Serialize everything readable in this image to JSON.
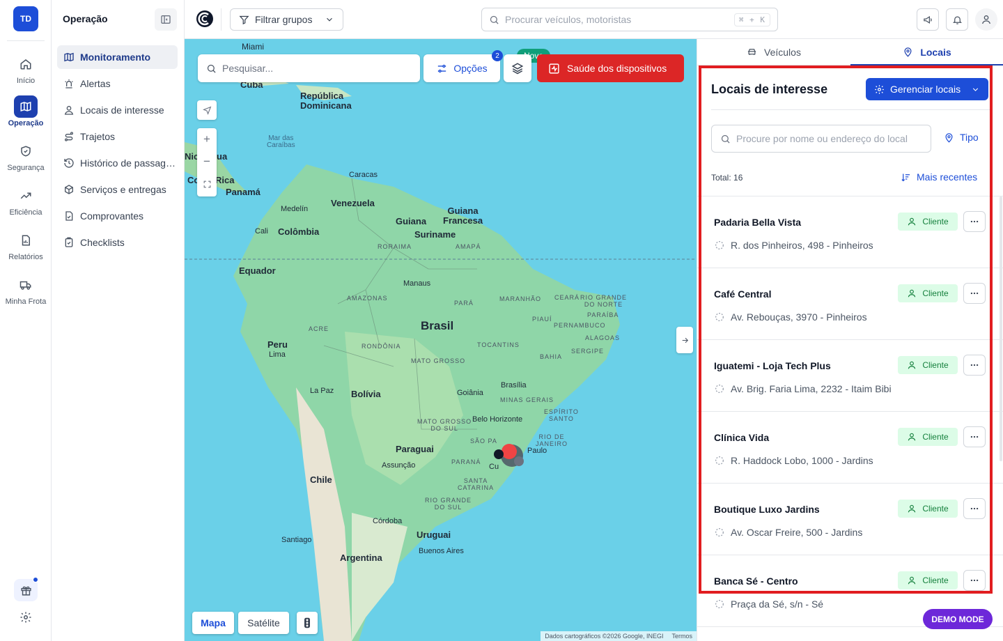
{
  "rail": {
    "avatar": "TD",
    "items": [
      {
        "label": "Início"
      },
      {
        "label": "Operação"
      },
      {
        "label": "Segurança"
      },
      {
        "label": "Eficiência"
      },
      {
        "label": "Relatórios"
      },
      {
        "label": "Minha Frota"
      }
    ]
  },
  "sidebar": {
    "title": "Operação",
    "items": [
      {
        "label": "Monitoramento"
      },
      {
        "label": "Alertas"
      },
      {
        "label": "Locais de interesse"
      },
      {
        "label": "Trajetos"
      },
      {
        "label": "Histórico de passagens"
      },
      {
        "label": "Serviços e entregas"
      },
      {
        "label": "Comprovantes"
      },
      {
        "label": "Checklists"
      }
    ]
  },
  "topbar": {
    "filter_label": "Filtrar grupos",
    "search_placeholder": "Procurar veículos, motoristas",
    "shortcut": "⌘ + K"
  },
  "map": {
    "search_placeholder": "Pesquisar...",
    "options_label": "Opções",
    "options_badge": "2",
    "new_tag": "Novo",
    "health_label": "Saúde dos dispositivos",
    "map_type_map": "Mapa",
    "map_type_satellite": "Satélite",
    "attribution": "Dados cartográficos ©2026 Google, INEGI",
    "terms": "Termos",
    "labels": {
      "miami": "Miami",
      "cuba": "Cuba",
      "dominicana": "República\nDominicana",
      "caribe": "Mar das\nCaraíbas",
      "caracas": "Caracas",
      "nicaragua": "Nic",
      "nicaragua2": "ua",
      "costarica": "Co",
      "costarica2": "Rica",
      "panama": "Panamá",
      "medellin": "Medelín",
      "venezuela": "Venezuela",
      "guiana": "Guiana",
      "guianafr": "Guiana\nFrancesa",
      "suriname": "Suriname",
      "cali": "Cali",
      "colombia": "Colômbia",
      "roraima": "RORAIMA",
      "amapa": "AMAPÁ",
      "equador": "Equador",
      "manaus": "Manaus",
      "amazonas": "AMAZONAS",
      "para": "PARÁ",
      "maranhao": "MARANHÃO",
      "ceara": "CEARÁ",
      "rgnorte": "RIO GRANDE\nDO NORTE",
      "paraiba": "PARAÍBA",
      "piaui": "PIAUÍ",
      "pernambuco": "PERNAMBUCO",
      "alagoas": "ALAGOAS",
      "sergipe": "SERGIPE",
      "acre": "ACRE",
      "brasil": "Brasil",
      "tocantins": "TOCANTINS",
      "bahia": "BAHIA",
      "rondonia": "RONDÔNIA",
      "matogrosso": "MATO GROSSO",
      "peru": "Peru",
      "lima": "Lima",
      "brasilia": "Brasília",
      "lapaz": "La Paz",
      "bolivia": "Bolívia",
      "goiania": "Goiânia",
      "minas": "MINAS GERAIS",
      "espirito": "ESPÍRITO\nSANTO",
      "ms": "MATO GROSSO\nDO SUL",
      "bh": "Belo Horizonte",
      "riojaneiro": "RIO DE\nJANEIRO",
      "saopaulo_st": "SÃO PA",
      "saopaulo": "Paulo",
      "paraguai": "Paraguai",
      "assuncao": "Assunção",
      "parana": "PARANÁ",
      "curitiba": "Cu",
      "chile": "Chile",
      "santacatarina": "SANTA\nCATARINA",
      "rgsul": "RIO GRANDE\nDO SUL",
      "cordoba": "Córdoba",
      "uruguai": "Uruguai",
      "santiago": "Santiago",
      "buenosaires": "Buenos Aires",
      "argentina": "Argentina"
    }
  },
  "panel": {
    "tabs": [
      {
        "label": "Veículos"
      },
      {
        "label": "Locais"
      }
    ],
    "title": "Locais de interesse",
    "manage_label": "Gerenciar locais",
    "search_placeholder": "Procure por nome ou endereço do local",
    "type_label": "Tipo",
    "total_label": "Total: 16",
    "sort_label": "Mais recentes",
    "locations": [
      {
        "name": "Padaria Bella Vista",
        "badge": "Cliente",
        "address": "R. dos Pinheiros, 498 - Pinheiros"
      },
      {
        "name": "Café Central",
        "badge": "Cliente",
        "address": "Av. Rebouças, 3970 - Pinheiros"
      },
      {
        "name": "Iguatemi - Loja Tech Plus",
        "badge": "Cliente",
        "address": "Av. Brig. Faria Lima, 2232 - Itaim Bibi"
      },
      {
        "name": "Clínica Vida",
        "badge": "Cliente",
        "address": "R. Haddock Lobo, 1000 - Jardins"
      },
      {
        "name": "Boutique Luxo Jardins",
        "badge": "Cliente",
        "address": "Av. Oscar Freire, 500 - Jardins"
      },
      {
        "name": "Banca Sé - Centro",
        "badge": "Cliente",
        "address": "Praça da Sé, s/n - Sé"
      }
    ],
    "demo_label": "DEMO MODE"
  },
  "colors": {
    "primary": "#1d4ed8",
    "danger": "#dc2626",
    "success_bg": "#dcfce7",
    "success_text": "#15803d",
    "ocean": "#6ad0e8",
    "land": "#8fd6a8",
    "demo": "#6d28d9",
    "highlight": "#e11d20"
  }
}
